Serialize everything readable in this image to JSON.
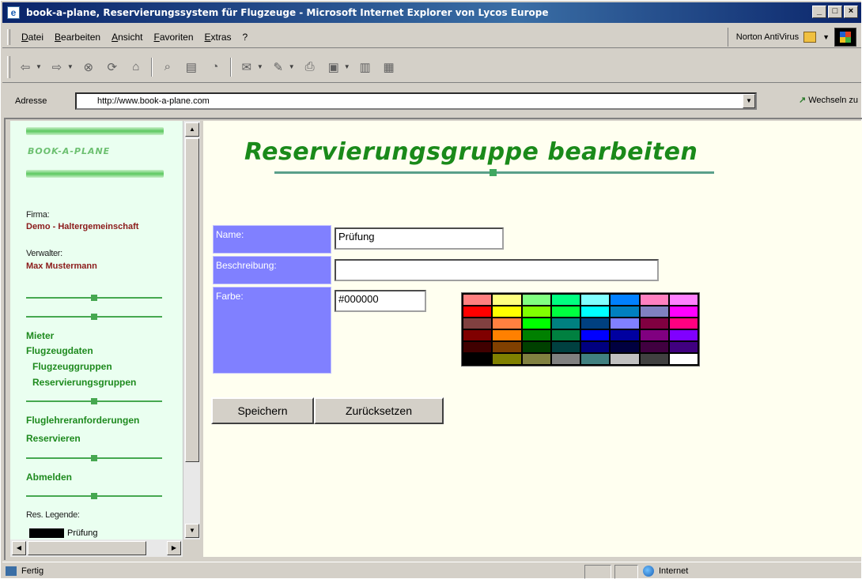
{
  "window": {
    "title": "book-a-plane, Reservierungssystem für Flugzeuge - Microsoft Internet Explorer von Lycos Europe",
    "controls": [
      "_",
      "□",
      "×"
    ]
  },
  "menu": {
    "items": [
      "Datei",
      "Bearbeiten",
      "Ansicht",
      "Favoriten",
      "Extras",
      "?"
    ],
    "norton": "Norton AntiVirus"
  },
  "toolbar": {
    "icons": [
      "back-icon",
      "forward-icon",
      "stop-icon",
      "refresh-icon",
      "home-icon",
      "search-icon",
      "favorites-icon",
      "history-icon",
      "mail-icon",
      "edit-icon",
      "print-icon",
      "discuss-icon",
      "messenger-icon",
      "tools-icon"
    ]
  },
  "address": {
    "label": "Adresse",
    "url": "http://www.book-a-plane.com",
    "go": "Wechseln zu"
  },
  "sidebar": {
    "logo": "BOOK-A-PLANE",
    "firma_label": "Firma:",
    "firma_value": "Demo - Haltergemeinschaft",
    "verwalter_label": "Verwalter:",
    "verwalter_value": "Max Mustermann",
    "links": {
      "mieter": "Mieter",
      "flugzeugdaten": "Flugzeugdaten",
      "flugzeuggruppen": "Flugzeuggruppen",
      "reservierungsgruppen": "Reservierungsgruppen",
      "fluglehrer": "Fluglehreranforderungen",
      "reservieren": "Reservieren",
      "abmelden": "Abmelden"
    },
    "legend_label": "Res. Legende:",
    "legend_item": "Prüfung",
    "legend_color": "#000000"
  },
  "main": {
    "title": "Reservierungsgruppe bearbeiten",
    "form": {
      "name_label": "Name:",
      "name_value": "Prüfung",
      "beschreibung_label": "Beschreibung:",
      "beschreibung_value": "",
      "farbe_label": "Farbe:",
      "farbe_value": "#000000"
    },
    "palette": [
      "#ff8080",
      "#ffff80",
      "#80ff80",
      "#00ff80",
      "#80ffff",
      "#0080ff",
      "#ff80c0",
      "#ff80ff",
      "#ff0000",
      "#ffff00",
      "#80ff00",
      "#00ff40",
      "#00ffff",
      "#0080c0",
      "#8080c0",
      "#ff00ff",
      "#804040",
      "#ff8040",
      "#00ff00",
      "#008080",
      "#004080",
      "#8080ff",
      "#800040",
      "#ff0080",
      "#800000",
      "#ff8000",
      "#008000",
      "#008040",
      "#0000ff",
      "#0000a0",
      "#800080",
      "#8000ff",
      "#400000",
      "#804000",
      "#004000",
      "#004040",
      "#000080",
      "#000040",
      "#400040",
      "#400080",
      "#000000",
      "#808000",
      "#808040",
      "#808080",
      "#408080",
      "#c0c0c0",
      "#404040",
      "#ffffff"
    ],
    "save_label": "Speichern",
    "reset_label": "Zurücksetzen"
  },
  "status": {
    "text": "Fertig",
    "zone": "Internet"
  }
}
